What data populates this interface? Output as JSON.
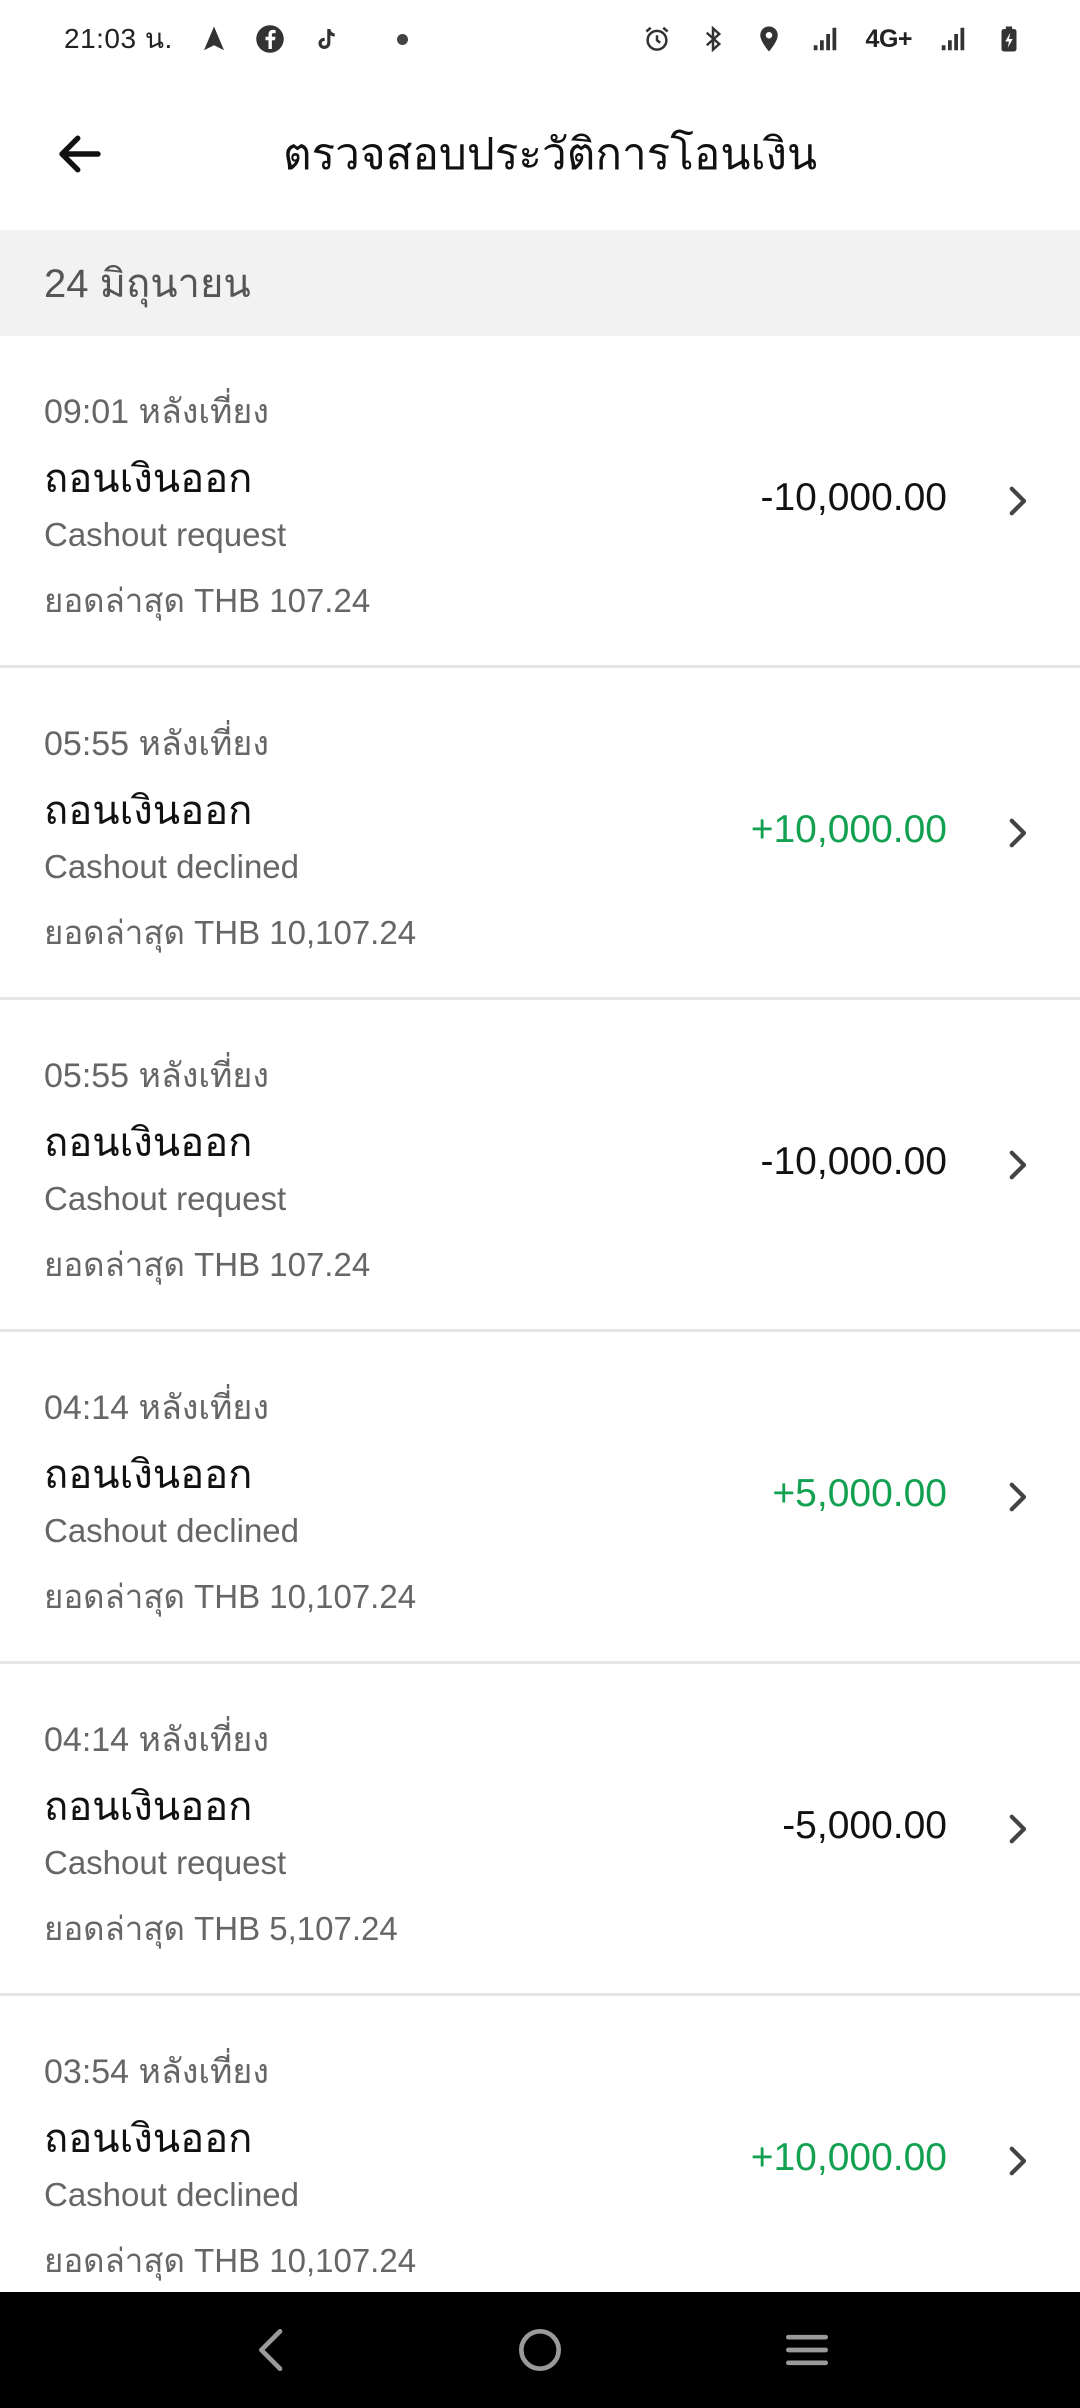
{
  "status_bar": {
    "time": "21:03 น.",
    "network": "4G+",
    "icons": [
      "navigation-icon",
      "facebook-icon",
      "tiktok-icon",
      "notification-dot",
      "alarm-icon",
      "bluetooth-icon",
      "location-icon",
      "signal-icon",
      "signal-icon",
      "battery-charging-icon"
    ]
  },
  "app_bar": {
    "back_icon": "arrow-left-icon",
    "title": "ตรวจสอบประวัติการโอนเงิน"
  },
  "section": {
    "date": "24 มิถุนายน"
  },
  "colors": {
    "positive": "#12a150",
    "negative": "#111111",
    "date_header_bg": "#f2f2f2",
    "nav_bar_bg": "#000000"
  },
  "transactions": [
    {
      "time": "09:01 หลังเที่ยง",
      "title": "ถอนเงินออก",
      "description": "Cashout request",
      "balance": "ยอดล่าสุด THB 107.24",
      "amount": "-10,000.00",
      "direction": "negative"
    },
    {
      "time": "05:55 หลังเที่ยง",
      "title": "ถอนเงินออก",
      "description": "Cashout declined",
      "balance": "ยอดล่าสุด THB 10,107.24",
      "amount": "+10,000.00",
      "direction": "positive"
    },
    {
      "time": "05:55 หลังเที่ยง",
      "title": "ถอนเงินออก",
      "description": "Cashout request",
      "balance": "ยอดล่าสุด THB 107.24",
      "amount": "-10,000.00",
      "direction": "negative"
    },
    {
      "time": "04:14 หลังเที่ยง",
      "title": "ถอนเงินออก",
      "description": "Cashout declined",
      "balance": "ยอดล่าสุด THB 10,107.24",
      "amount": "+5,000.00",
      "direction": "positive"
    },
    {
      "time": "04:14 หลังเที่ยง",
      "title": "ถอนเงินออก",
      "description": "Cashout request",
      "balance": "ยอดล่าสุด THB 5,107.24",
      "amount": "-5,000.00",
      "direction": "negative"
    },
    {
      "time": "03:54 หลังเที่ยง",
      "title": "ถอนเงินออก",
      "description": "Cashout declined",
      "balance": "ยอดล่าสุด THB 10,107.24",
      "amount": "+10,000.00",
      "direction": "positive"
    }
  ],
  "nav_bar": {
    "buttons": [
      "back-nav-icon",
      "home-nav-icon",
      "recents-nav-icon"
    ]
  }
}
